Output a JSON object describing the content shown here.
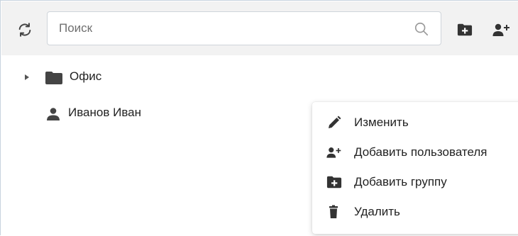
{
  "toolbar": {
    "refresh_icon": "refresh-icon",
    "search": {
      "placeholder": "Поиск",
      "value": "",
      "icon": "search-icon"
    },
    "add_group_icon": "folder-plus-icon",
    "add_user_icon": "user-plus-icon"
  },
  "tree": {
    "items": [
      {
        "type": "folder",
        "label": "Офис",
        "icon": "folder-icon",
        "expanded": false
      },
      {
        "type": "user",
        "label": "Иванов Иван",
        "icon": "user-icon"
      }
    ]
  },
  "context_menu": {
    "items": [
      {
        "label": "Изменить",
        "icon": "pencil-icon"
      },
      {
        "label": "Добавить пользователя",
        "icon": "user-plus-icon"
      },
      {
        "label": "Добавить группу",
        "icon": "folder-plus-icon"
      },
      {
        "label": "Удалить",
        "icon": "trash-icon"
      }
    ]
  },
  "colors": {
    "toolbar_bg": "#f2f2f2",
    "icon": "#333333",
    "text": "#222222"
  }
}
